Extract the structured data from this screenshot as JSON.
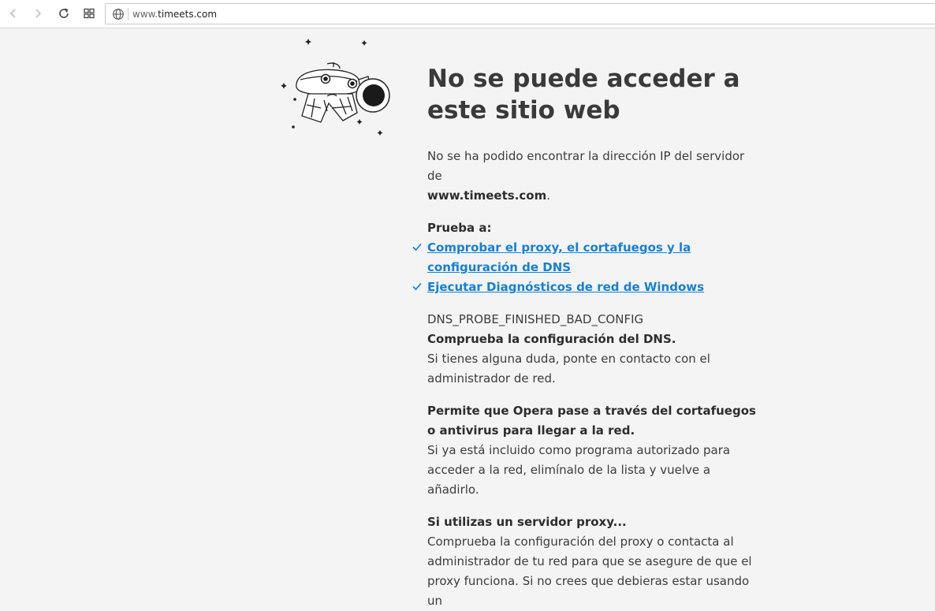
{
  "browser": {
    "url_prefix": "www.",
    "url_host": "timeets.com"
  },
  "error": {
    "title": "No se puede acceder a este sitio web",
    "summary_prefix": "No se ha podido encontrar la dirección IP del servidor de",
    "summary_host": "www.timeets.com",
    "summary_suffix": ".",
    "try_heading": "Prueba a:",
    "suggestions": [
      "Comprobar el proxy, el cortafuegos y la configuración de DNS",
      "Ejecutar Diagnósticos de red de Windows"
    ],
    "error_code": "DNS_PROBE_FINISHED_BAD_CONFIG",
    "details": [
      {
        "heading": "Comprueba la configuración del DNS.",
        "text": "Si tienes alguna duda, ponte en contacto con el administrador de red."
      },
      {
        "heading": "Permite que Opera pase a través del cortafuegos o antivirus para llegar a la red.",
        "text": "Si ya está incluido como programa autorizado para acceder a la red, elimínalo de la lista y vuelve a añadirlo."
      },
      {
        "heading": "Si utilizas un servidor proxy...",
        "text": "Comprueba la configuración del proxy o contacta al administrador de tu red para que se asegure de que el proxy funciona. Si no crees que debieras estar usando un"
      }
    ]
  },
  "colors": {
    "link": "#1780d5",
    "background": "#f4f4f5"
  }
}
